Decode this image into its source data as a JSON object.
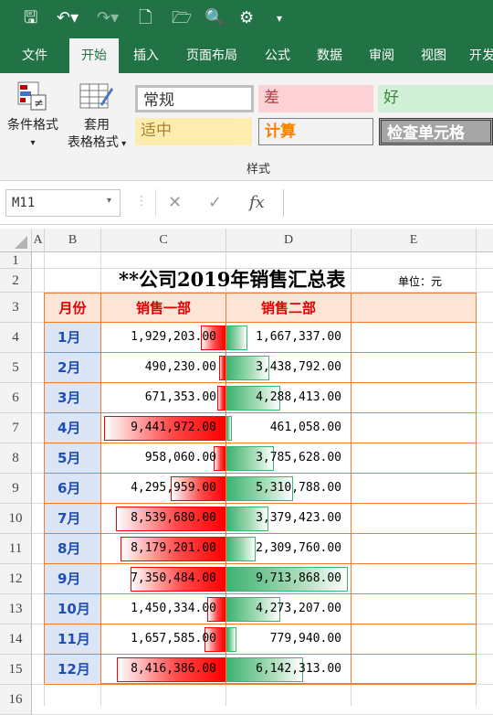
{
  "window": {
    "qat_icons": [
      "save-icon",
      "undo-icon",
      "redo-icon",
      "new-file-icon",
      "open-folder-icon",
      "print-preview-icon",
      "touch-mode-icon",
      "customize-icon"
    ]
  },
  "tabs": [
    "文件",
    "开始",
    "插入",
    "页面布局",
    "公式",
    "数据",
    "审阅",
    "视图",
    "开发"
  ],
  "active_tab": 1,
  "ribbon": {
    "cond_format": "条件格式",
    "table_format_1": "套用",
    "table_format_2": "表格格式",
    "styles": {
      "normal": "常规",
      "bad": "差",
      "good": "好",
      "neutral": "适中",
      "calc": "计算",
      "check": "检查单元格"
    },
    "group_label": "样式"
  },
  "formula_bar": {
    "name_box": "M11",
    "cancel": "✕",
    "enter": "✓",
    "fx": "fx",
    "formula": ""
  },
  "columns": [
    "A",
    "B",
    "C",
    "D",
    "E"
  ],
  "rows": [
    "1",
    "2",
    "3",
    "4",
    "5",
    "6",
    "7",
    "8",
    "9",
    "10",
    "11",
    "12",
    "13",
    "14",
    "15",
    "16"
  ],
  "sheet": {
    "title": "**公司2019年销售汇总表",
    "unit": "单位：元",
    "headers": [
      "月份",
      "销售一部",
      "销售二部",
      ""
    ],
    "data": [
      {
        "month": "1月",
        "d1": "1,929,203.00",
        "d2": "1,667,337.00"
      },
      {
        "month": "2月",
        "d1": "490,230.00",
        "d2": "3,438,792.00"
      },
      {
        "month": "3月",
        "d1": "671,353.00",
        "d2": "4,288,413.00"
      },
      {
        "month": "4月",
        "d1": "9,441,972.00",
        "d2": "461,058.00"
      },
      {
        "month": "5月",
        "d1": "958,060.00",
        "d2": "3,785,628.00"
      },
      {
        "month": "6月",
        "d1": "4,295,959.00",
        "d2": "5,310,788.00"
      },
      {
        "month": "7月",
        "d1": "8,539,680.00",
        "d2": "3,379,423.00"
      },
      {
        "month": "8月",
        "d1": "8,179,201.00",
        "d2": "2,309,760.00"
      },
      {
        "month": "9月",
        "d1": "7,350,484.00",
        "d2": "9,713,868.00"
      },
      {
        "month": "10月",
        "d1": "1,450,334.00",
        "d2": "4,273,207.00"
      },
      {
        "month": "11月",
        "d1": "1,657,585.00",
        "d2": "779,940.00"
      },
      {
        "month": "12月",
        "d1": "8,416,386.00",
        "d2": "6,142,313.00"
      }
    ],
    "bar_colors": {
      "dept1": "#ff0000",
      "dept2": "#3cb371"
    }
  }
}
